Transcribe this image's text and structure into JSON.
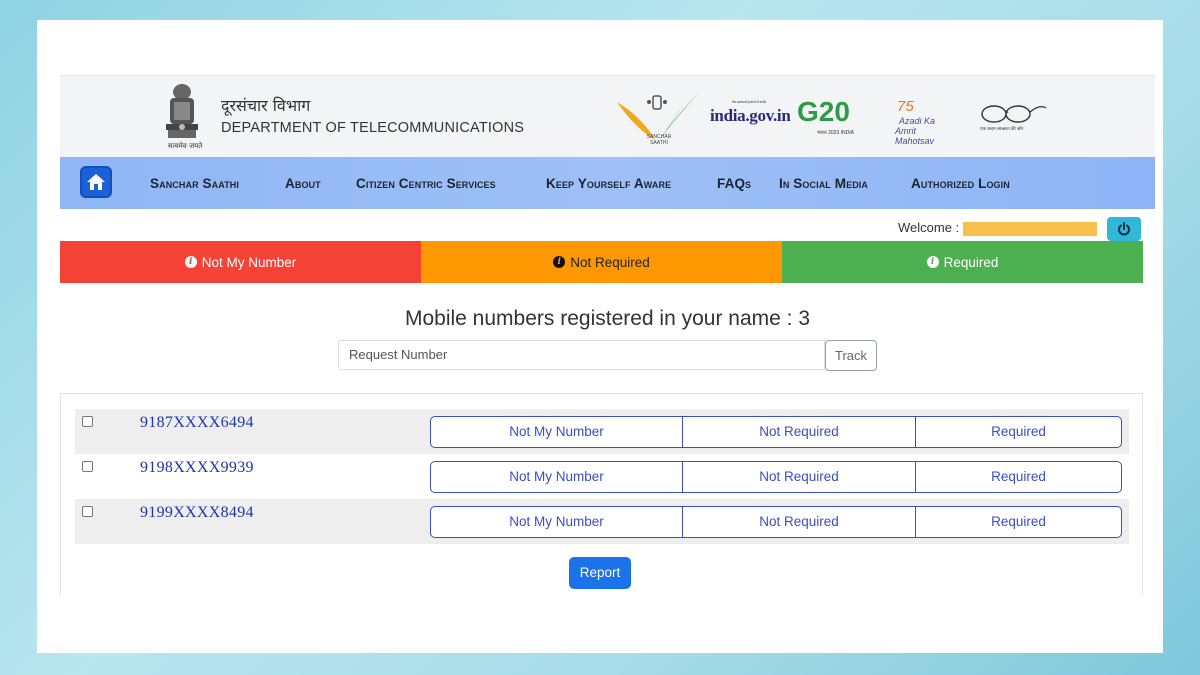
{
  "header": {
    "emblem_caption": "सत्यमेव जयते",
    "dept_hindi": "दूरसंचार विभाग",
    "dept_english": "DEPARTMENT OF TELECOMMUNICATIONS",
    "logos": {
      "saathi_label": "SANCHAR SAATHI",
      "india_gov": "india.gov.in",
      "india_gov_sub": "the national portal of india",
      "g20": "G20",
      "g20_sub": "भारत 2023 INDIA",
      "azadi_75": "75",
      "azadi_line1": "Azadi Ka",
      "azadi_line2": "Amrit Mahotsav",
      "swachh_caption": "एक कदम स्वच्छता की ओर"
    }
  },
  "nav": {
    "items": [
      {
        "label": "Sanchar Saathi"
      },
      {
        "label": "About"
      },
      {
        "label": "Citizen Centric Services"
      },
      {
        "label": "Keep Yourself Aware"
      },
      {
        "label": "FAQs"
      },
      {
        "label": "In Social Media"
      },
      {
        "label": "Authorized Login"
      }
    ]
  },
  "welcome": {
    "label": "Welcome :"
  },
  "status_legend": [
    {
      "label": "Not My Number",
      "color": "#f44336"
    },
    {
      "label": "Not Required",
      "color": "#ff9800"
    },
    {
      "label": "Required",
      "color": "#4caf50"
    }
  ],
  "main": {
    "title": "Mobile numbers registered in your name : 3",
    "request_placeholder": "Request Number",
    "track_label": "Track",
    "report_label": "Report"
  },
  "numbers": [
    {
      "number": "9187XXXX6494",
      "options": [
        "Not My Number",
        "Not Required",
        "Required"
      ]
    },
    {
      "number": "9198XXXX9939",
      "options": [
        "Not My Number",
        "Not Required",
        "Required"
      ]
    },
    {
      "number": "9199XXXX8494",
      "options": [
        "Not My Number",
        "Not Required",
        "Required"
      ]
    }
  ]
}
